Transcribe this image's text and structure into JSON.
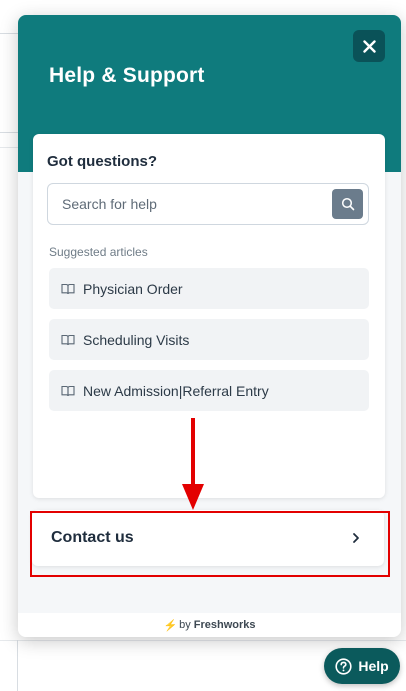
{
  "widget": {
    "title": "Help & Support",
    "close_icon": "close-icon",
    "card": {
      "title": "Got questions?",
      "search": {
        "placeholder": "Search for help",
        "value": "",
        "icon": "search-icon"
      },
      "section_label": "Suggested articles",
      "articles": [
        {
          "label": "Physician Order",
          "icon": "book-icon"
        },
        {
          "label": "Scheduling Visits",
          "icon": "book-icon"
        },
        {
          "label": "New Admission|Referral Entry",
          "icon": "book-icon"
        }
      ]
    },
    "contact": {
      "label": "Contact us",
      "icon": "chevron-right-icon"
    },
    "footer": {
      "prefix": "by",
      "brand": "Freshworks",
      "icon": "bolt-icon"
    }
  },
  "launcher": {
    "label": "Help",
    "icon": "question-circle-icon"
  },
  "colors": {
    "header": "#0f7b7d",
    "close_button": "#0a5258",
    "launcher": "#0b5a5c",
    "annotation": "#e30000",
    "bolt": "#f5b400"
  }
}
